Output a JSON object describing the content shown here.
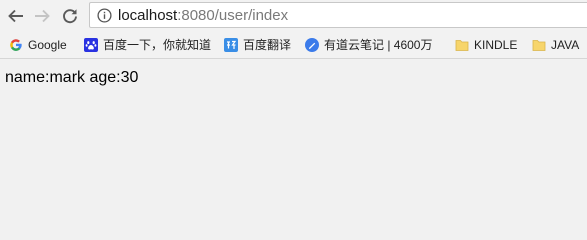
{
  "browser": {
    "url_host": "localhost",
    "url_rest": ":8080/user/index"
  },
  "bookmarks": [
    {
      "label": "Google",
      "icon": "google-g-icon"
    },
    {
      "label": "百度一下，你就知道",
      "icon": "baidu-paw-icon"
    },
    {
      "label": "百度翻译",
      "icon": "baidu-translate-icon"
    },
    {
      "label": "有道云笔记 | 4600万",
      "icon": "youdao-note-icon"
    },
    {
      "label": "KINDLE",
      "icon": "folder-icon"
    },
    {
      "label": "JAVA",
      "icon": "folder-icon"
    }
  ],
  "page": {
    "text": "name:mark age:30"
  },
  "colors": {
    "page_background": "#f1f1f1",
    "folder": "#f7d56b",
    "baidu_blue": "#2932e1",
    "translate_blue": "#3a8ee6",
    "youdao_blue": "#3b7bea"
  }
}
